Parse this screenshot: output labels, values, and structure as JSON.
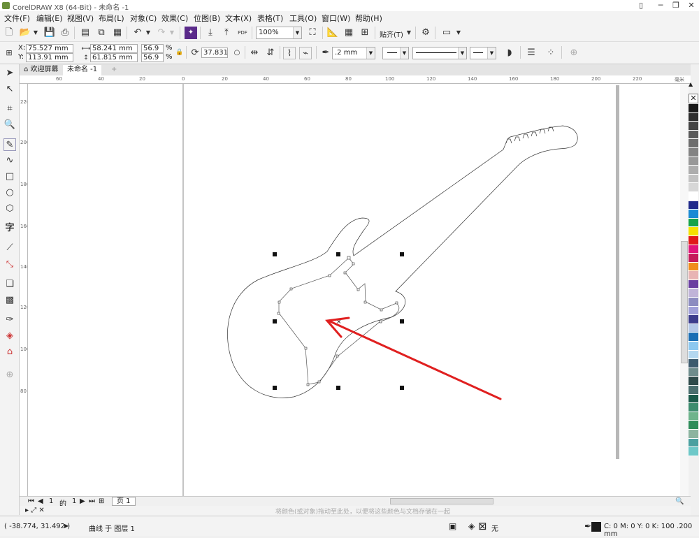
{
  "window": {
    "title": "CorelDRAW X8 (64-Bit) - 未命名 -1"
  },
  "menu": [
    "文件(F)",
    "编辑(E)",
    "视图(V)",
    "布局(L)",
    "对象(C)",
    "效果(C)",
    "位图(B)",
    "文本(X)",
    "表格(T)",
    "工具(O)",
    "窗口(W)",
    "帮助(H)"
  ],
  "toolbar1": {
    "zoom": "100%",
    "snap_label": "贴齐(T)",
    "pdf_label": "PDF"
  },
  "props": {
    "x_label": "X:",
    "x_value": "75.527 mm",
    "y_label": "Y:",
    "y_value": "113.91 mm",
    "w_value": "58.241 mm",
    "h_value": "61.815 mm",
    "sx_value": "56.9",
    "sy_value": "56.9",
    "pct": "%",
    "rotation": "37.831",
    "outline_width": ".2 mm"
  },
  "tabs": {
    "welcome": "欢迎屏幕",
    "doc": "未命名 -1",
    "add": "+"
  },
  "ruler_h": [
    "60",
    "40",
    "20",
    "0",
    "20",
    "40",
    "60",
    "80",
    "100",
    "120",
    "140",
    "160",
    "180",
    "200",
    "220",
    "毫米"
  ],
  "ruler_v": [
    "220",
    "200",
    "180",
    "160",
    "140",
    "120",
    "100",
    "80"
  ],
  "pager": {
    "current": "1",
    "of": "的",
    "total": "1",
    "page_tab": "页 1"
  },
  "status_hint": "将颜色(或对象)拖动至此处，以便将这些颜色与文档存储在一起",
  "statusbar": {
    "coords": "( -38.774, 31.492 )",
    "object_info": "曲线 于 图层 1",
    "fill_none": "无",
    "outline_info": "C: 0 M: 0 Y: 0 K: 100  .200 mm"
  },
  "colors": {
    "arrow": "#e02020",
    "palette": [
      "#1a1a1a",
      "#2e2e2e",
      "#444444",
      "#595959",
      "#6e6e6e",
      "#838383",
      "#989898",
      "#adadad",
      "#c2c2c2",
      "#d7d7d7",
      "#ffffff",
      "#1f2a8a",
      "#1a8ad4",
      "#15a34a",
      "#f5e200",
      "#e01a1a",
      "#e0157a",
      "#c41a5a",
      "#f08c1a",
      "#e8b4b4",
      "#6a3ea0",
      "#c0b4d8",
      "#8c8cc0",
      "#a0a0d8",
      "#3c3c8c",
      "#b4c8e8",
      "#1a6eb4",
      "#8cc8f0",
      "#b4d8f0",
      "#3c5a6e",
      "#6e8c8c",
      "#2e4a4a",
      "#4a6e6e",
      "#1a5a4a",
      "#3c8c6e",
      "#6eb48c",
      "#2e8c5a",
      "#8cb4a0",
      "#4aa0a0",
      "#6ec8c8"
    ]
  }
}
